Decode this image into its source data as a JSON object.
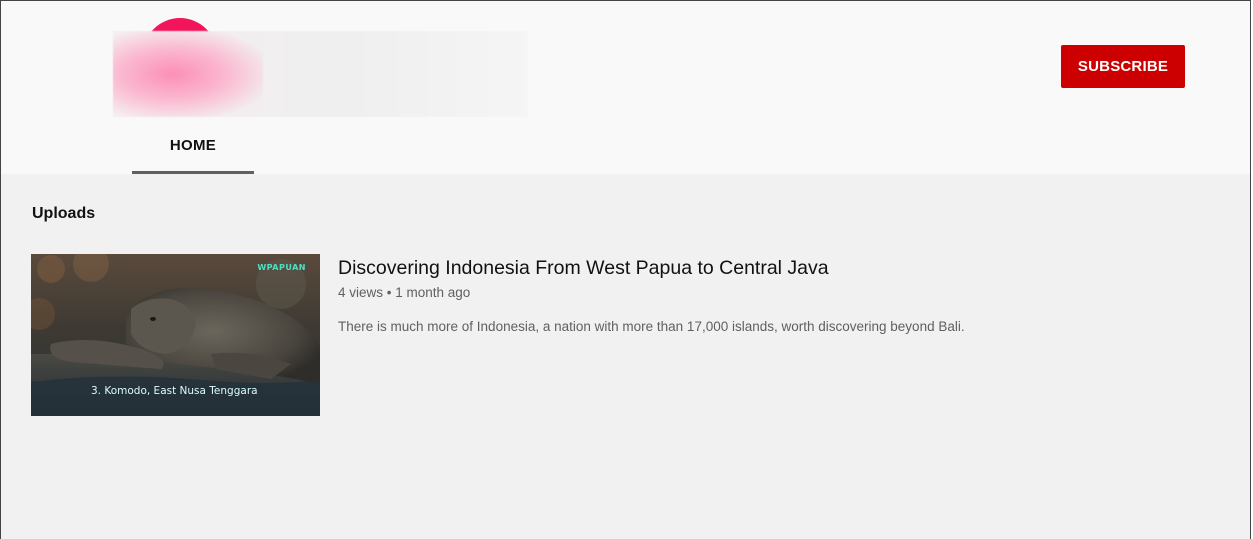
{
  "header": {
    "subscribe_label": "SUBSCRIBE",
    "tabs": [
      {
        "label": "HOME",
        "selected": true
      }
    ]
  },
  "colors": {
    "subscribe_bg": "#cc0000",
    "avatar_accent": "#f2155c",
    "tab_underline": "#606060"
  },
  "uploads": {
    "section_title": "Uploads",
    "videos": [
      {
        "title": "Discovering Indonesia From West Papua to Central Java",
        "meta": "4 views • 1 month ago",
        "description": "There is much more of Indonesia, a nation with more than 17,000 islands, worth discovering beyond Bali.",
        "thumbnail": {
          "caption": "3. Komodo, East Nusa Tenggara",
          "watermark": "PAPUAN",
          "watermark_icon": "w-logo-icon"
        }
      }
    ]
  }
}
